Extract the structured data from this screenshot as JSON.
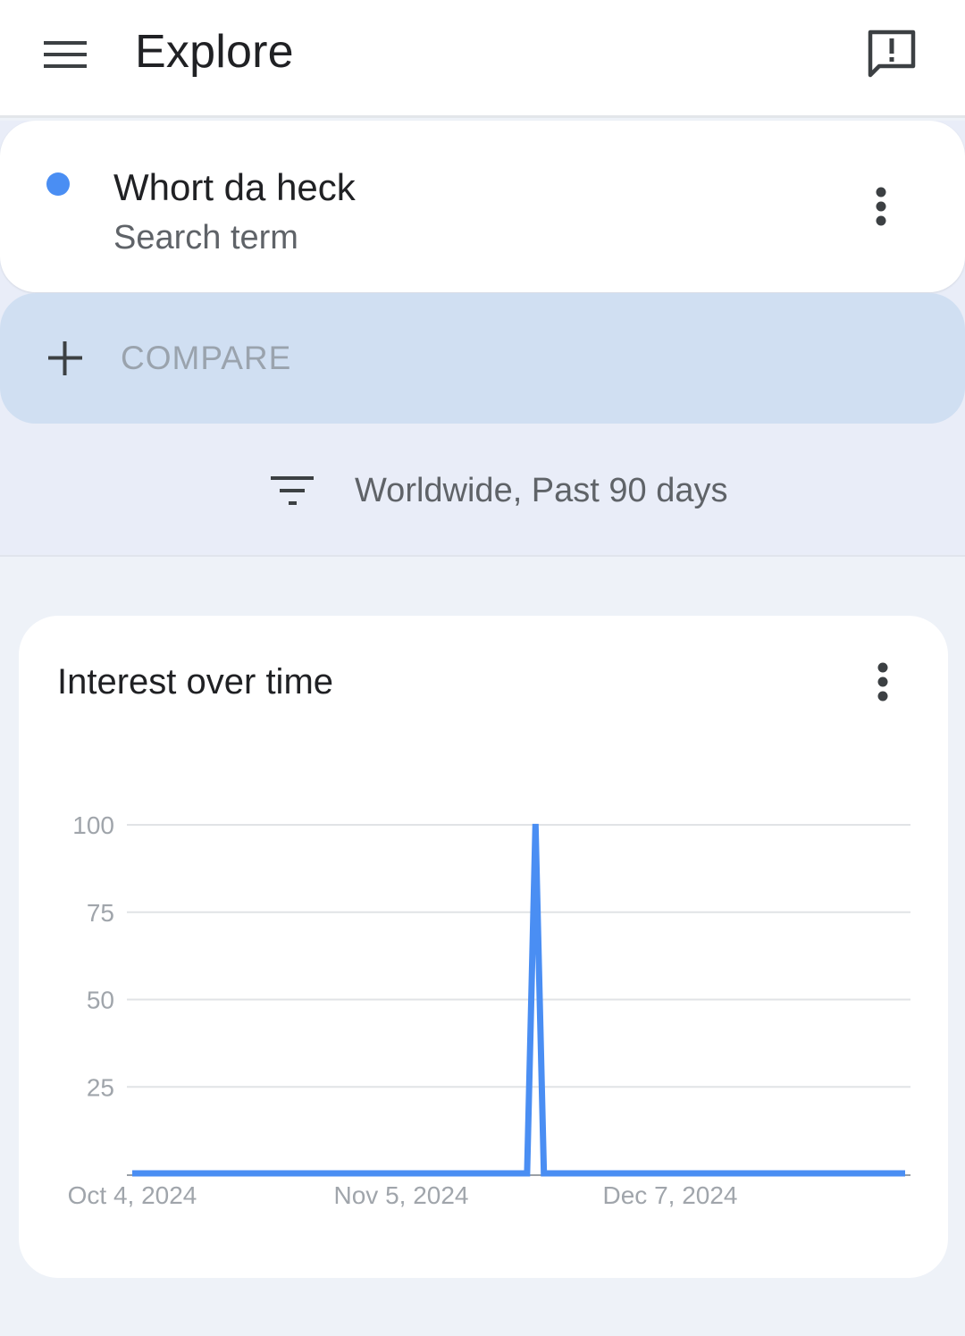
{
  "app_bar": {
    "title": "Explore",
    "menu_icon": "hamburger-menu-icon",
    "feedback_icon": "feedback-icon"
  },
  "search_term": {
    "title": "Whort da heck",
    "subtitle": "Search term",
    "color": "#4a8ef3",
    "more_icon": "more-vert-icon"
  },
  "compare": {
    "label": "COMPARE",
    "icon": "plus-icon"
  },
  "filter": {
    "label": "Worldwide, Past 90 days",
    "icon": "filter-icon"
  },
  "chart_card": {
    "title": "Interest over time",
    "more_icon": "more-vert-icon"
  },
  "chart_data": {
    "type": "line",
    "title": "Interest over time",
    "xlabel": "",
    "ylabel": "",
    "ylim": [
      0,
      100
    ],
    "yticks": [
      100,
      75,
      50,
      25
    ],
    "x_tick_labels": [
      "Oct 4, 2024",
      "Nov 5, 2024",
      "Dec 7, 2024"
    ],
    "grid": true,
    "legend": "none",
    "color": "#4a8ef3",
    "series": [
      {
        "values": [
          0,
          0,
          0,
          0,
          0,
          0,
          0,
          0,
          0,
          0,
          0,
          0,
          0,
          0,
          0,
          0,
          0,
          0,
          0,
          0,
          0,
          0,
          0,
          0,
          0,
          0,
          0,
          0,
          0,
          0,
          0,
          0,
          0,
          0,
          0,
          0,
          0,
          0,
          0,
          0,
          0,
          0,
          0,
          0,
          0,
          0,
          0,
          0,
          100,
          0,
          0,
          0,
          0,
          0,
          0,
          0,
          0,
          0,
          0,
          0,
          0,
          0,
          0,
          0,
          0,
          0,
          0,
          0,
          0,
          0,
          0,
          0,
          0,
          0,
          0,
          0,
          0,
          0,
          0,
          0,
          0,
          0,
          0,
          0,
          0,
          0,
          0,
          0,
          0,
          0,
          0,
          0,
          0
        ]
      }
    ]
  }
}
